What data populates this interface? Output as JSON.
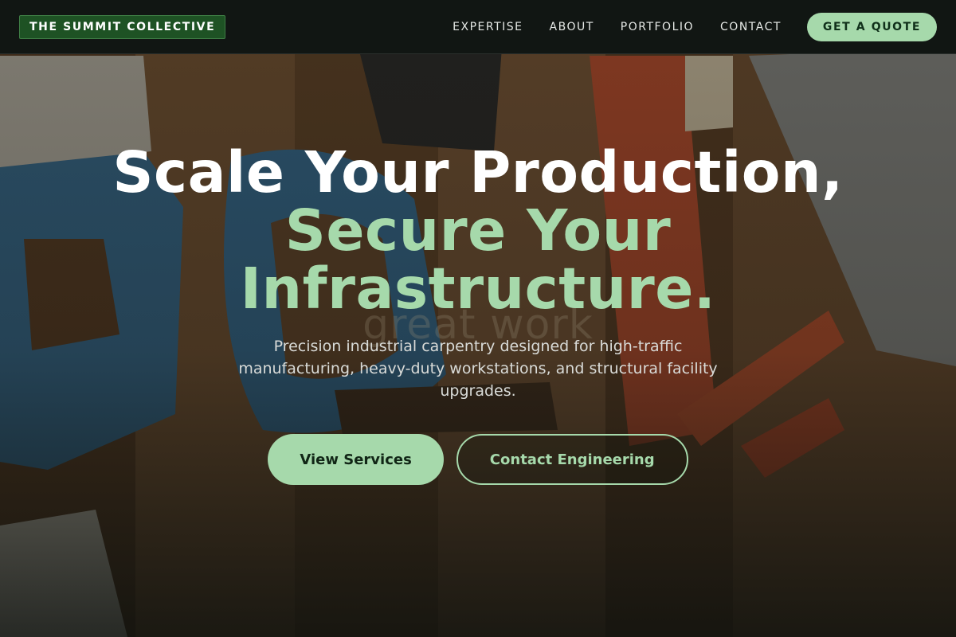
{
  "brand": {
    "name": "THE SUMMIT COLLECTIVE"
  },
  "nav": {
    "links": [
      "EXPERTISE",
      "ABOUT",
      "PORTFOLIO",
      "CONTACT"
    ],
    "cta_label": "GET A QUOTE"
  },
  "hero": {
    "headline_line1": "Scale Your Production,",
    "headline_line2": "Secure Your",
    "headline_line3": "Infrastructure.",
    "background_text": "great work",
    "subtitle": "Precision industrial carpentry designed for high-traffic manufacturing, heavy-duty workstations, and structural facility upgrades.",
    "primary_button": "View Services",
    "secondary_button": "Contact Engineering"
  },
  "colors": {
    "accent": "#a6d9ab",
    "nav_background": "#111613",
    "logo_background": "#1e5224"
  }
}
